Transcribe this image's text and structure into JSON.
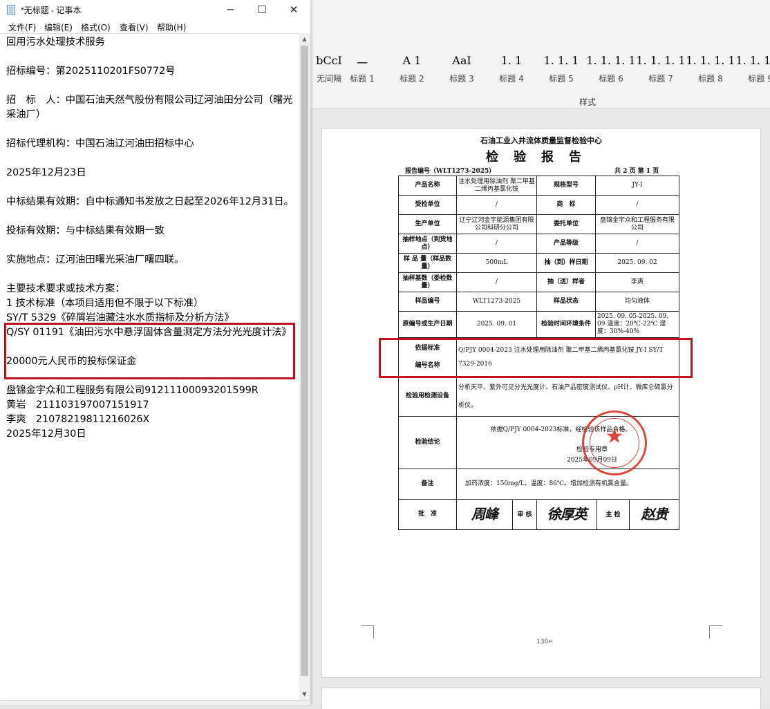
{
  "word": {
    "styles": [
      {
        "sample": "bCcI",
        "name": "无间隔"
      },
      {
        "sample": "一",
        "name": "标题 1"
      },
      {
        "sample": "A  1",
        "name": "标题 2"
      },
      {
        "sample": "AaI",
        "name": "标题 3"
      },
      {
        "sample": "1. 1",
        "name": "标题 4"
      },
      {
        "sample": "1. 1. 1",
        "name": "标题 5"
      },
      {
        "sample": "1. 1. 1. 1",
        "name": "标题 6"
      },
      {
        "sample": "1. 1. 1. 1",
        "name": "标题 7"
      },
      {
        "sample": "1. 1. 1. 1",
        "name": "标题 8"
      },
      {
        "sample": "1. 1. 1. 1",
        "name": "标题 9"
      }
    ],
    "styles_group_label": "样式",
    "page_number": "130↵",
    "report": {
      "org": "石油工业入井流体质量监督检验中心",
      "title": "检验报告",
      "report_no": "报告编号（WLT1273-2025）",
      "pages": "共 2 页  第 1 页",
      "rows": {
        "product_name_label": "产品名称",
        "product_name": "注水处理用除油剂 聚二甲基二烯丙基氯化铵",
        "spec_label": "规格型号",
        "spec": "JY-I",
        "receiver_label": "受检单位",
        "receiver": "/",
        "brand_label": "商　标",
        "brand": "/",
        "producer_label": "生产单位",
        "producer": "辽宁辽河金宇能源集团有限公司科研分公司",
        "client_label": "委托单位",
        "client": "盘锦金宇众和工程服务有限公司",
        "sampling_site_label": "抽样地点（到货地点）",
        "sampling_site": "/",
        "grade_label": "产品等级",
        "grade": "/",
        "sample_qty_label": "样 品 量（样品数量）",
        "sample_qty": "500mL",
        "sample_date_label": "抽（到）样日期",
        "sample_date": "2025. 09. 02",
        "sample_base_label": "抽样基数（委检数量）",
        "sample_base": "/",
        "sender_label": "抽（送）样者",
        "sender": "李爽",
        "sample_no_label": "样品编号",
        "sample_no": "WLT1273-2025",
        "sample_state_label": "样品状态",
        "sample_state": "均匀液体",
        "orig_no_label": "原编号或生产日期",
        "orig_no": "2025. 09. 01",
        "test_time_label": "检验时间环境条件",
        "test_time": "2025. 09. 05-2025. 09. 09 温度：20℃-22℃ 湿度：30%-40%",
        "basis_label": "依据标准",
        "basis": "Q/PJY 0004-2023 注水处理用除油剂 聚二甲基二烯丙基氯化铵 JY-I SY/T 7329-2016",
        "code_label": "编号名称",
        "equipment_label": "检验用检测设备",
        "equipment": "分析天平、紫外可见分光光度计、石油产品密度测试仪、pH计、微库仑硫氯分析仪。",
        "conclusion_label": "检验结论",
        "conclusion": "依据Q/PJY 0004-2023标准，经检验该样品合格。",
        "stamp_text": "检验专用章",
        "stamp_date": "2025年09月09日",
        "remark_label": "备注",
        "remark": "加药浓度：150mg/L，温度：86℃。增加检测有机氯含量。",
        "approve_label": "批　准",
        "approve_sig": "周峰",
        "review_label": "审 核",
        "review_sig": "徐厚英",
        "inspect_label": "主 检",
        "inspect_sig": "赵贵"
      }
    }
  },
  "notepad": {
    "title": "*无标题 - 记事本",
    "menu": [
      "文件(F)",
      "编辑(E)",
      "格式(O)",
      "查看(V)",
      "帮助(H)"
    ],
    "content": "回用污水处理技术服务\n\n招标编号：第2025110201FS0772号\n\n招　标　人：中国石油天然气股份有限公司辽河油田分公司（曙光采油厂）\n\n招标代理机构：中国石油辽河油田招标中心\n\n2025年12月23日\n\n中标结果有效期：自中标通知书发放之日起至2026年12月31日。\n\n投标有效期：与中标结果有效期一致\n\n实施地点：辽河油田曙光采油厂曙四联。\n\n主要技术要求或技术方案：\n1 技术标准（本项目适用但不限于以下标准）\nSY/T 5329《碎屑岩油藏注水水质指标及分析方法》\nQ/SY 01191《油田污水中悬浮固体含量测定方法分光光度计法》\n\n20000元人民币的投标保证金\n\n盘锦金宇众和工程服务有限公司91211100093201599R\n黄岩　211103197007151917\n李爽　21078219811216026X\n2025年12月30日"
  }
}
